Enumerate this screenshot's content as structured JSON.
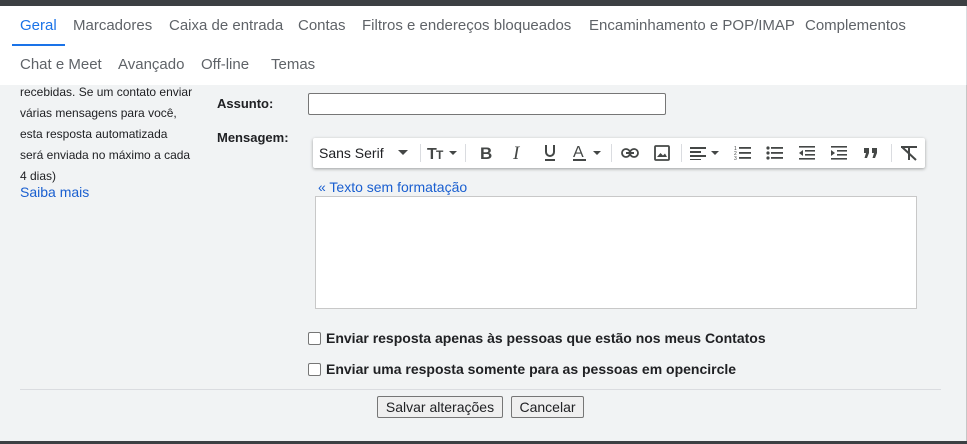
{
  "tabs": {
    "row1": [
      {
        "label": "Geral",
        "active": true
      },
      {
        "label": "Marcadores"
      },
      {
        "label": "Caixa de entrada"
      },
      {
        "label": "Contas"
      },
      {
        "label": "Filtros e endereços bloqueados"
      },
      {
        "label": "Encaminhamento e POP/IMAP"
      },
      {
        "label": "Complementos"
      }
    ],
    "row2": [
      {
        "label": "Chat e Meet"
      },
      {
        "label": "Avançado"
      },
      {
        "label": "Off-line"
      },
      {
        "label": "Temas"
      }
    ]
  },
  "description": {
    "lines": [
      "recebidas. Se um contato enviar",
      "várias mensagens para você,",
      "esta resposta automatizada",
      "será enviada no máximo a cada",
      "4 dias)"
    ],
    "learn_more": "Saiba mais"
  },
  "form": {
    "subject_label": "Assunto:",
    "subject_value": "",
    "message_label": "Mensagem:",
    "plain_text_link": "« Texto sem formatação",
    "message_value": ""
  },
  "toolbar": {
    "font_name": "Sans Serif",
    "icons": [
      "font-size-icon",
      "bold-icon",
      "italic-icon",
      "underline-icon",
      "text-color-icon",
      "link-icon",
      "image-icon",
      "align-icon",
      "numbered-list-icon",
      "bulleted-list-icon",
      "indent-less-icon",
      "indent-more-icon",
      "quote-icon",
      "remove-formatting-icon"
    ]
  },
  "checkboxes": [
    {
      "label": "Enviar resposta apenas às pessoas que estão nos meus Contatos",
      "checked": false
    },
    {
      "label": "Enviar uma resposta somente para as pessoas em opencircle",
      "checked": false
    }
  ],
  "actions": {
    "save": "Salvar alterações",
    "cancel": "Cancelar"
  },
  "colors": {
    "accent": "#1a73e8",
    "link": "#1a5fd0",
    "panel_bg": "#f1f3f4"
  }
}
